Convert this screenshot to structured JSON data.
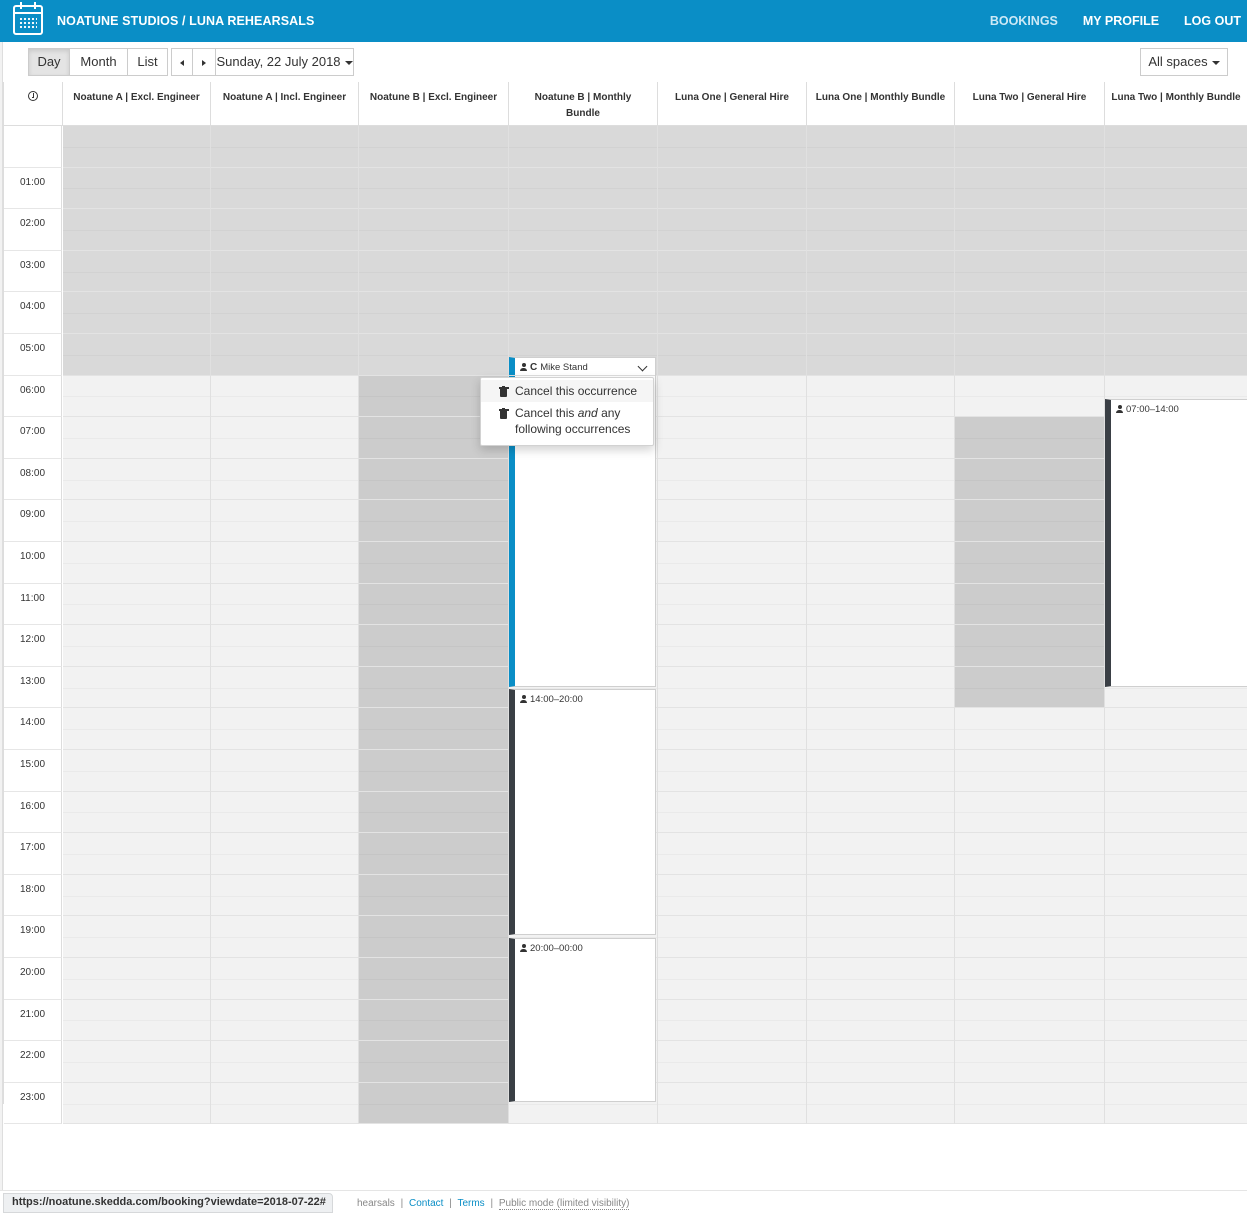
{
  "header": {
    "brand": "NOATUNE STUDIOS / LUNA REHEARSALS",
    "nav": [
      {
        "label": "BOOKINGS",
        "active": true
      },
      {
        "label": "MY PROFILE",
        "active": false
      },
      {
        "label": "LOG OUT",
        "active": false
      }
    ]
  },
  "toolbar": {
    "views": [
      "Day",
      "Month",
      "List"
    ],
    "active_view": "Day",
    "date_label": "Sunday, 22 July 2018",
    "spaces_label": "All spaces"
  },
  "columns": [
    "Noatune A | Excl. Engineer",
    "Noatune A | Incl. Engineer",
    "Noatune B | Excl. Engineer",
    "Noatune B | Monthly Bundle",
    "Luna One | General Hire",
    "Luna One | Monthly Bundle",
    "Luna Two | General Hire",
    "Luna Two | Monthly Bundle"
  ],
  "hours": [
    "",
    "01:00",
    "02:00",
    "03:00",
    "04:00",
    "05:00",
    "06:00",
    "07:00",
    "08:00",
    "09:00",
    "10:00",
    "11:00",
    "12:00",
    "13:00",
    "14:00",
    "15:00",
    "16:00",
    "17:00",
    "18:00",
    "19:00",
    "20:00",
    "21:00",
    "22:00",
    "23:00"
  ],
  "bookings": [
    {
      "label": "Mike Stand",
      "recurring": true,
      "expanded": true
    },
    {
      "label": "14:00–20:00",
      "recurring": false
    },
    {
      "label": "20:00–00:00",
      "recurring": false
    },
    {
      "label": "07:00–14:00",
      "recurring": false
    }
  ],
  "menu": {
    "item1": "Cancel this occurrence",
    "item2_a": "Cancel this ",
    "item2_em": "and",
    "item2_b": " any",
    "item2_line2": "following occurrences"
  },
  "footer": {
    "partial_text": "hearsals",
    "contact": "Contact",
    "terms": "Terms",
    "public_mode": "Public mode (limited visibility)",
    "separator": "|"
  },
  "status_url": "https://noatune.skedda.com/booking?viewdate=2018-07-22#",
  "colors": {
    "brand": "#0a8ec6",
    "unavailable": "#d9d9d9",
    "blocked": "#cccccc",
    "open": "#f2f2f2",
    "booking_bar": "#3a3f45"
  }
}
